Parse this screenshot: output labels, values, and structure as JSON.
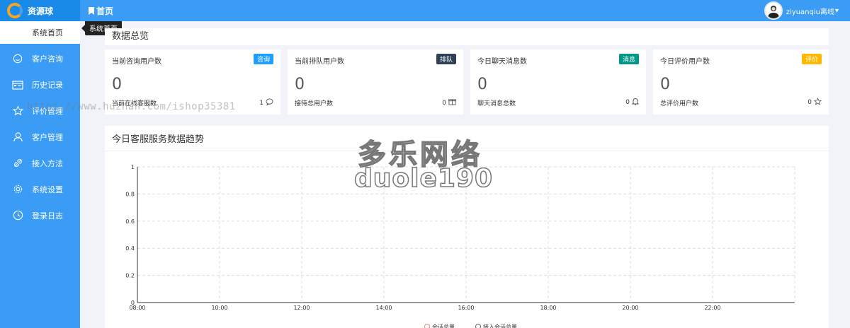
{
  "brand": {
    "title": "资源球"
  },
  "sidebar": {
    "active": "系统首页",
    "items": [
      {
        "label": "客户咨询",
        "icon": "smile-icon"
      },
      {
        "label": "历史记录",
        "icon": "calendar-icon"
      },
      {
        "label": "评价管理",
        "icon": "star-icon"
      },
      {
        "label": "客户管理",
        "icon": "user-icon"
      },
      {
        "label": "接入方法",
        "icon": "plug-icon"
      },
      {
        "label": "系统设置",
        "icon": "gear-icon"
      },
      {
        "label": "登录日志",
        "icon": "clock-icon"
      }
    ]
  },
  "tooltip": "系统首页",
  "header": {
    "title": "首页",
    "user": "ziyuanqiu离线"
  },
  "overview": {
    "title": "数据总览"
  },
  "cards": [
    {
      "title": "当前咨询用户数",
      "tag": "咨询",
      "tag_color": "#1e9fff",
      "value": "0",
      "sub_label": "当前在线客服数",
      "sub_value": "1",
      "icon": "chat-icon"
    },
    {
      "title": "当前排队用户数",
      "tag": "排队",
      "tag_color": "#2f4056",
      "value": "0",
      "sub_label": "接待总用户数",
      "sub_value": "0",
      "icon": "gift-icon"
    },
    {
      "title": "今日聊天消息数",
      "tag": "消息",
      "tag_color": "#009688",
      "value": "0",
      "sub_label": "聊天消息总数",
      "sub_value": "0",
      "icon": "bell-icon"
    },
    {
      "title": "今日评价用户数",
      "tag": "评价",
      "tag_color": "#ffb800",
      "value": "0",
      "sub_label": "总评价用户数",
      "sub_value": "0",
      "icon": "star-icon"
    }
  ],
  "watermark": {
    "url": "https://www.huzhan.com/ishop35381",
    "line1": "多乐网络",
    "line2": "duole190"
  },
  "chart_data": {
    "type": "line",
    "title": "今日客服服务数据趋势",
    "x": [
      "08:00",
      "10:00",
      "12:00",
      "14:00",
      "16:00",
      "18:00",
      "20:00",
      "22:00"
    ],
    "yticks": [
      "0",
      "0.2",
      "0.4",
      "0.6",
      "0.8",
      "1"
    ],
    "ylim": [
      0,
      1
    ],
    "grid": true,
    "legend": [
      "会话总量",
      "接入会话总量"
    ],
    "series": [
      {
        "name": "会话总量",
        "values": []
      },
      {
        "name": "接入会话总量",
        "values": []
      }
    ]
  }
}
